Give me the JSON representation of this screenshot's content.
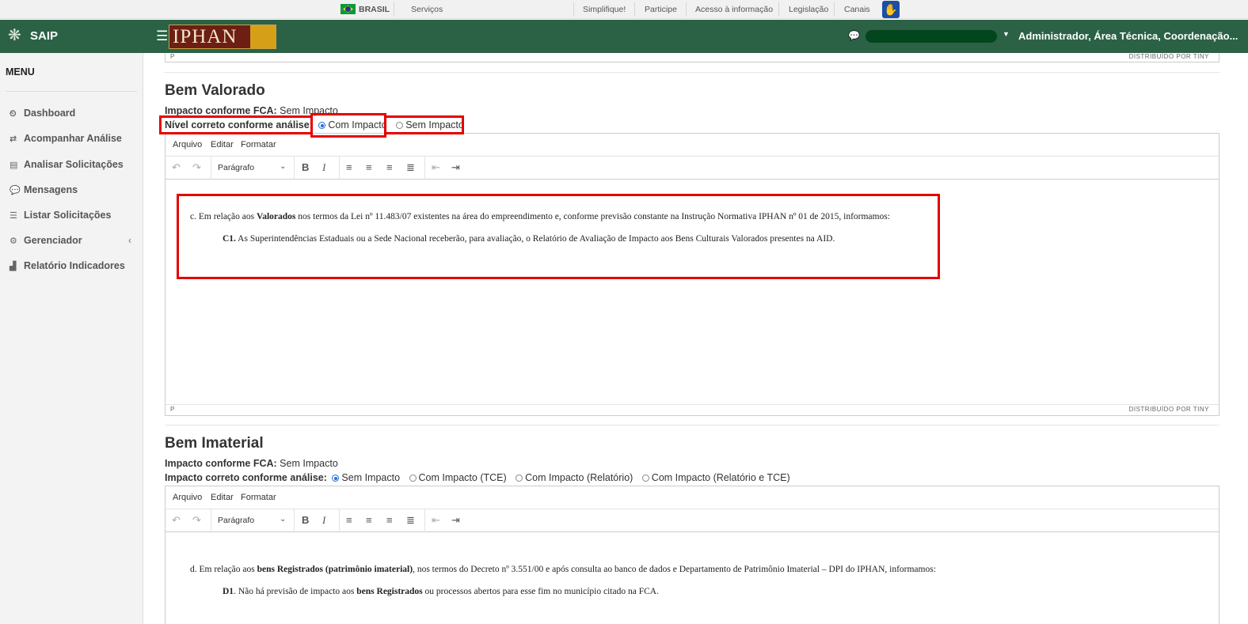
{
  "govbar": {
    "country": "BRASIL",
    "services": "Serviços",
    "links": [
      "Simplifique!",
      "Participe",
      "Acesso à informação",
      "Legislação",
      "Canais"
    ]
  },
  "header": {
    "app_name": "SAIP",
    "logo_text": "IPHAN",
    "user": "Administrador, Área Técnica, Coordenação..."
  },
  "sidebar": {
    "title": "MENU",
    "items": [
      {
        "label": "Dashboard",
        "icon": "dashboard-icon"
      },
      {
        "label": "Acompanhar Análise",
        "icon": "exchange-icon"
      },
      {
        "label": "Analisar Solicitações",
        "icon": "book-icon"
      },
      {
        "label": "Mensagens",
        "icon": "comments-icon"
      },
      {
        "label": "Listar Solicitações",
        "icon": "list-icon"
      },
      {
        "label": "Gerenciador",
        "icon": "cogs-icon"
      },
      {
        "label": "Relatório Indicadores",
        "icon": "area-chart-icon"
      }
    ]
  },
  "editor_common": {
    "menu": [
      "Arquivo",
      "Editar",
      "Formatar"
    ],
    "format_select": "Parágrafo",
    "status_path": "P",
    "status_brand": "DISTRIBUÍDO POR TINY"
  },
  "valorado": {
    "title": "Bem Valorado",
    "fca_label": "Impacto conforme FCA:",
    "fca_value": "Sem Impacto",
    "level_label": "Nível correto conforme análise:",
    "options": [
      "Com Impacto",
      "Sem Impacto"
    ],
    "selected": "Com Impacto",
    "paragraph1_prefix": "c. Em relação aos ",
    "paragraph1_bold": "Valorados",
    "paragraph1_suffix": " nos termos da Lei nº 11.483/07 existentes na área do empreendimento e, conforme previsão constante na Instrução Normativa IPHAN nº 01 de 2015, informamos:",
    "paragraph2_bold": "C1.",
    "paragraph2_text": " As Superintendências Estaduais ou a Sede Nacional receberão, para avaliação, o Relatório de Avaliação de Impacto aos Bens Culturais Valorados presentes na AID."
  },
  "imaterial": {
    "title": "Bem Imaterial",
    "fca_label": "Impacto conforme FCA:",
    "fca_value": "Sem Impacto",
    "level_label": "Impacto correto conforme análise:",
    "options": [
      "Sem Impacto",
      "Com Impacto (TCE)",
      "Com Impacto (Relatório)",
      "Com Impacto (Relatório e TCE)"
    ],
    "selected": "Sem Impacto",
    "paragraph1_prefix": "d. Em relação aos ",
    "paragraph1_bold": "bens Registrados (patrimônio imaterial)",
    "paragraph1_suffix": ", nos termos do Decreto nº 3.551/00 e após consulta ao banco de dados e Departamento de Patrimônio Imaterial – DPI do IPHAN, informamos:",
    "paragraph2_bold": "D1",
    "paragraph2_text1": ". Não há previsão de impacto aos ",
    "paragraph2_bold2": "bens Registrados",
    "paragraph2_text2": " ou processos abertos para esse fim no município citado na FCA."
  },
  "colors": {
    "header_green": "#2b6245",
    "highlight_red": "#e60000",
    "radio_blue": "#1a6fd6"
  }
}
